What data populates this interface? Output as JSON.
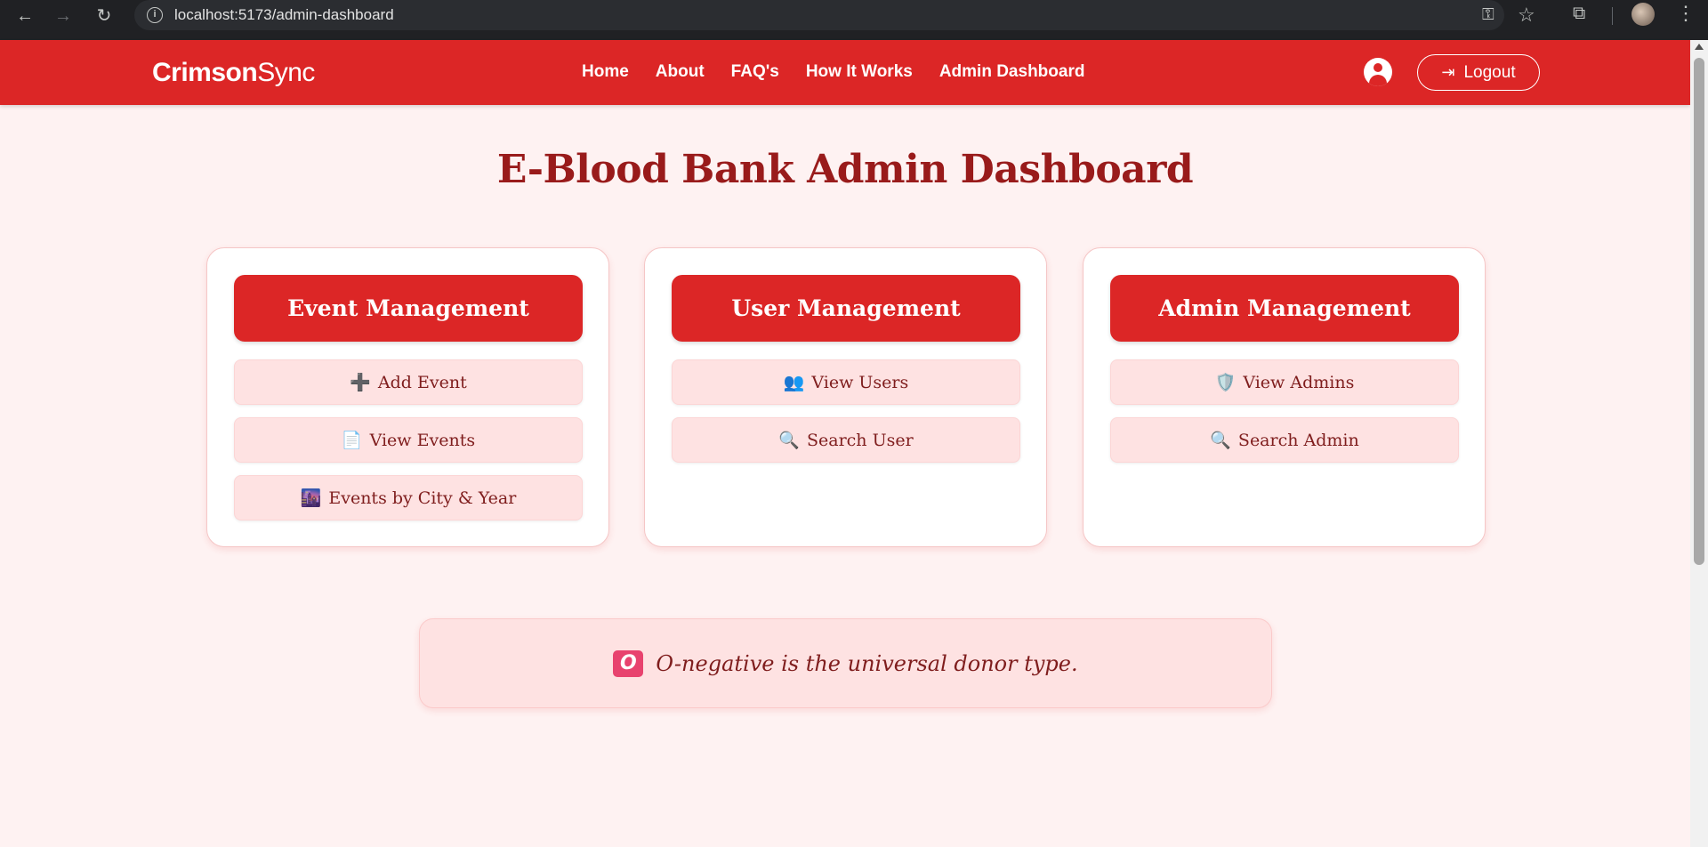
{
  "browser": {
    "url": "localhost:5173/admin-dashboard",
    "icons": [
      "back-arrow-icon",
      "forward-arrow-icon",
      "reload-icon",
      "site-info-icon",
      "password-key-icon",
      "bookmark-star-icon",
      "extensions-icon",
      "profile-avatar",
      "kebab-menu-icon"
    ]
  },
  "navbar": {
    "brand_bold": "Crimson",
    "brand_light": "Sync",
    "links": [
      "Home",
      "About",
      "FAQ's",
      "How It Works",
      "Admin Dashboard"
    ],
    "logout_label": "Logout",
    "accent_color": "#dc2626"
  },
  "page": {
    "title": "E-Blood Bank Admin Dashboard"
  },
  "cards": [
    {
      "title": "Event Management",
      "buttons": [
        {
          "icon": "➕",
          "label": "Add Event"
        },
        {
          "icon": "📄",
          "label": "View Events"
        },
        {
          "icon": "🌆",
          "label": "Events by City & Year"
        }
      ]
    },
    {
      "title": "User Management",
      "buttons": [
        {
          "icon": "👥",
          "label": "View Users"
        },
        {
          "icon": "🔍",
          "label": "Search User"
        }
      ]
    },
    {
      "title": "Admin Management",
      "buttons": [
        {
          "icon": "🛡️",
          "label": "View Admins"
        },
        {
          "icon": "🔍",
          "label": "Search Admin"
        }
      ]
    }
  ],
  "fact": {
    "badge": "O",
    "text": "O-negative is the universal donor type."
  }
}
